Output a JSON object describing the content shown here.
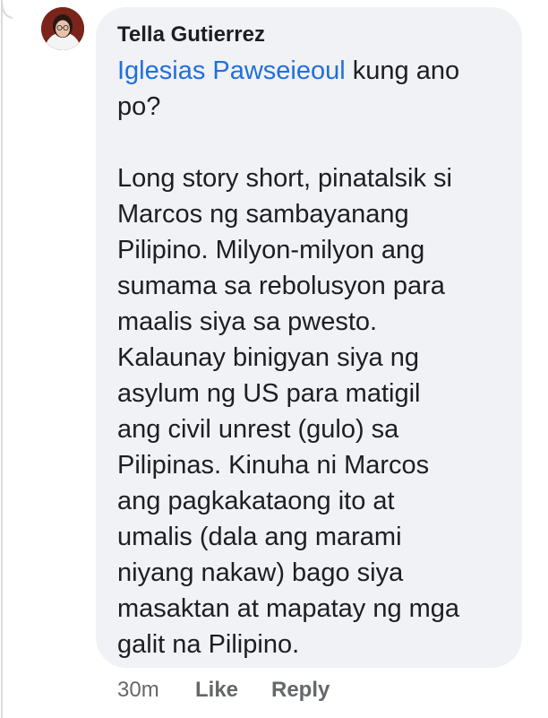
{
  "comment": {
    "author": "Tella Gutierrez",
    "mention": "Iglesias Pawseieoul",
    "first_line_rest": " kung ano",
    "lines": [
      "po?",
      "",
      "Long story short, pinatalsik si",
      "Marcos ng sambayanang",
      "Pilipino. Milyon-milyon ang",
      "sumama sa rebolusyon para",
      "maalis siya sa pwesto.",
      "Kalaunay binigyan siya ng",
      "asylum ng US para matigil",
      "ang civil unrest (gulo) sa",
      "Pilipinas. Kinuha ni Marcos",
      "ang pagkakataong ito at",
      "umalis (dala ang marami",
      "niyang nakaw) bago siya",
      "masaktan at mapatay ng mga",
      "galit na Pilipino."
    ],
    "timestamp": "30m",
    "like_label": "Like",
    "reply_label": "Reply",
    "colors": {
      "bubble": "#f0f2f5",
      "mention": "#216fdb",
      "text": "#1c1e21",
      "meta": "#65676b"
    }
  }
}
